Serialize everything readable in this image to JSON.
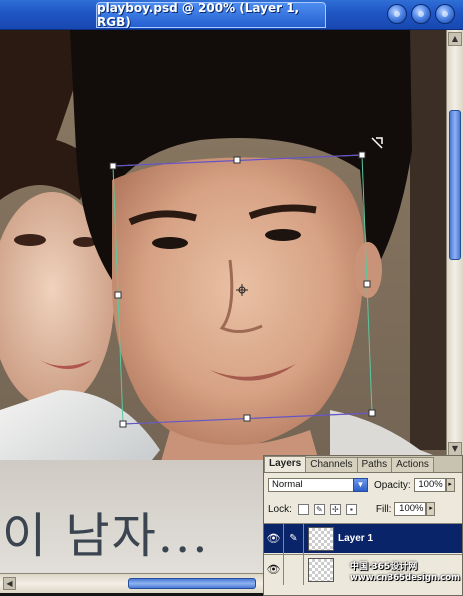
{
  "window": {
    "title": "playboy.psd @ 200% (Layer 1, RGB)"
  },
  "canvas": {
    "overlay_text": "이 남자..."
  },
  "layers_panel": {
    "tabs": [
      "Layers",
      "Channels",
      "Paths",
      "Actions"
    ],
    "blend_mode": "Normal",
    "opacity_label": "Opacity:",
    "opacity_value": "100%",
    "lock_label": "Lock:",
    "fill_label": "Fill:",
    "fill_value": "100%",
    "layers": [
      {
        "name": "Layer 1",
        "selected": true,
        "visible": true
      },
      {
        "name": "",
        "selected": false,
        "visible": true
      }
    ]
  },
  "watermark": {
    "line1": "中国·365设计网",
    "line2": "www.cn365design.com"
  },
  "icons": {
    "window_buttons": [
      "minimize-icon",
      "maximize-icon",
      "close-icon"
    ],
    "eye": "eye-icon",
    "brush": "brush-icon",
    "move": "move-icon",
    "lock": "lock-icon"
  },
  "colors": {
    "title_bar": "#1f55c4",
    "selected_layer": "#0a246a",
    "panel_bg": "#ece9dc"
  }
}
